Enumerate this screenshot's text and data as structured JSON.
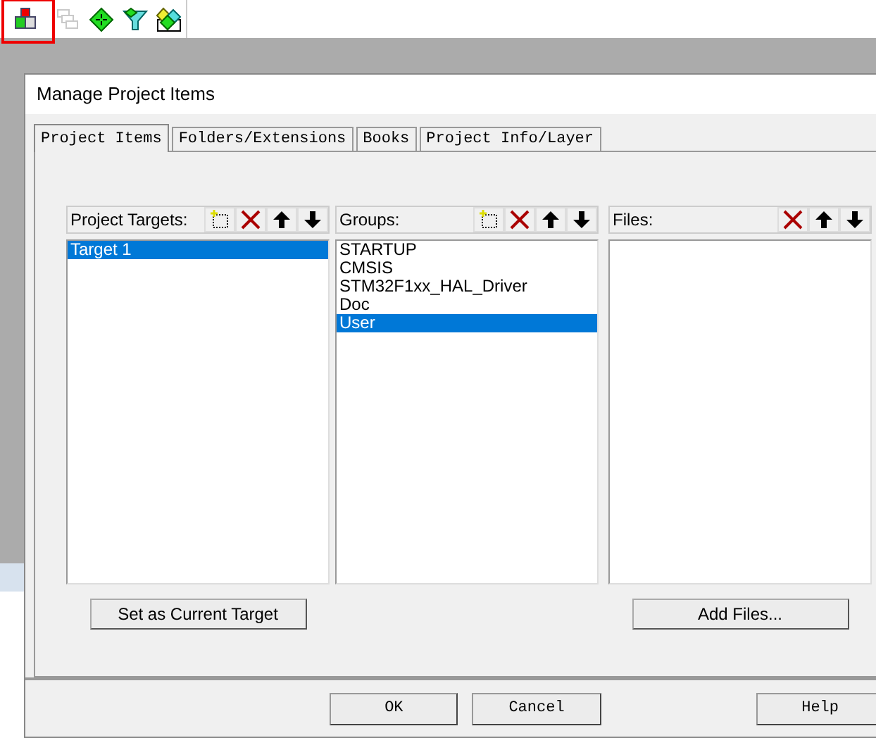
{
  "toolbar": [
    {
      "kind": "project",
      "highlighted": true,
      "disabled": false
    },
    {
      "kind": "windows",
      "highlighted": false,
      "disabled": true
    },
    {
      "kind": "diamond",
      "highlighted": false,
      "disabled": false
    },
    {
      "kind": "filter",
      "highlighted": false,
      "disabled": false
    },
    {
      "kind": "books",
      "highlighted": false,
      "disabled": false
    }
  ],
  "dialog": {
    "title": "Manage Project Items",
    "tabs": [
      {
        "label": "Project Items",
        "selected": true
      },
      {
        "label": "Folders/Extensions",
        "selected": false
      },
      {
        "label": "Books",
        "selected": false
      },
      {
        "label": "Project Info/Layer",
        "selected": false
      }
    ],
    "panels": [
      {
        "header": "Project Targets:",
        "tools": [
          {
            "kind": "new"
          },
          {
            "kind": "delete"
          },
          {
            "kind": "up"
          },
          {
            "kind": "down"
          }
        ],
        "items": [
          {
            "label": "Target 1",
            "selected": true
          }
        ],
        "button": "Set as Current Target"
      },
      {
        "header": "Groups:",
        "tools": [
          {
            "kind": "new"
          },
          {
            "kind": "delete"
          },
          {
            "kind": "up"
          },
          {
            "kind": "down"
          }
        ],
        "items": [
          {
            "label": "STARTUP",
            "selected": false
          },
          {
            "label": "CMSIS",
            "selected": false
          },
          {
            "label": "STM32F1xx_HAL_Driver",
            "selected": false
          },
          {
            "label": "Doc",
            "selected": false
          },
          {
            "label": "User",
            "selected": true
          }
        ]
      },
      {
        "header": "Files:",
        "tools": [
          {
            "kind": "delete"
          },
          {
            "kind": "up"
          },
          {
            "kind": "down"
          }
        ],
        "button": "Add Files..."
      }
    ],
    "buttons": [
      {
        "label": "OK",
        "kind": "ok"
      },
      {
        "label": "Cancel",
        "kind": "cancel"
      },
      {
        "label": "Help",
        "kind": "help"
      }
    ]
  }
}
